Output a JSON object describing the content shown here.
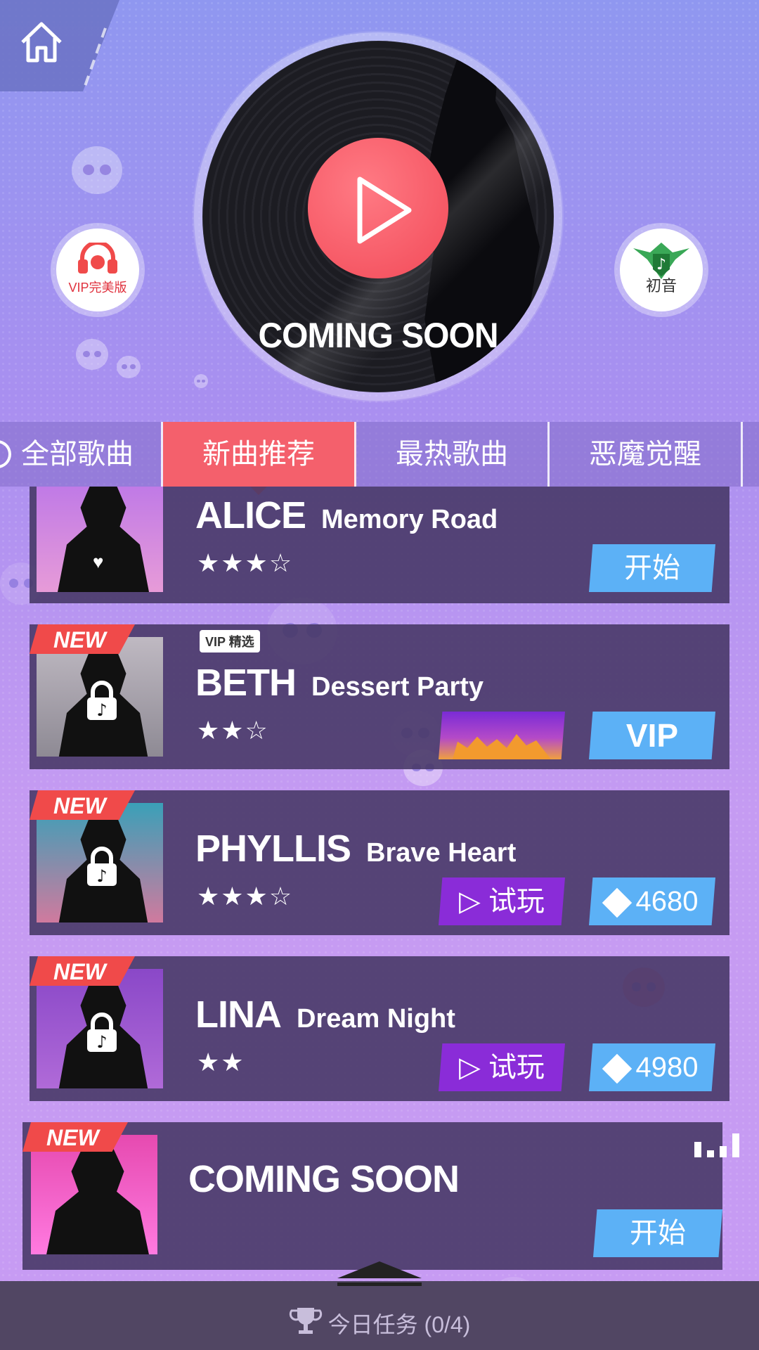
{
  "disc": {
    "title": "COMING SOON"
  },
  "badges": {
    "vip_label": "VIP完美版",
    "hatsune_label": "初音"
  },
  "tabs": [
    {
      "label": "全部歌曲",
      "active": false
    },
    {
      "label": "新曲推荐",
      "active": true
    },
    {
      "label": "最热歌曲",
      "active": false
    },
    {
      "label": "恶魔觉醒",
      "active": false
    }
  ],
  "songs": [
    {
      "character": "ALICE",
      "title": "Memory Road",
      "stars": "★★★☆",
      "new": false,
      "action": "开始"
    },
    {
      "character": "BETH",
      "title": "Dessert Party",
      "stars": "★★☆",
      "new": true,
      "tag": "NEW",
      "vip_tag": "VIP 精选",
      "action": "VIP"
    },
    {
      "character": "PHYLLIS",
      "title": "Brave Heart",
      "stars": "★★★☆",
      "new": true,
      "tag": "NEW",
      "trial": "▷ 试玩",
      "price": "4680"
    },
    {
      "character": "LINA",
      "title": "Dream Night",
      "stars": "★★",
      "new": true,
      "tag": "NEW",
      "trial": "▷ 试玩",
      "price": "4980"
    },
    {
      "character": "COMING SOON",
      "new": true,
      "tag": "NEW",
      "action": "开始"
    }
  ],
  "bottom": {
    "task": "今日任务 (0/4)"
  },
  "colors": {
    "accent_red": "#f4606c",
    "button_blue": "#5cb1f6",
    "button_purple": "#8a2cd8",
    "card_bg": "#463764"
  }
}
